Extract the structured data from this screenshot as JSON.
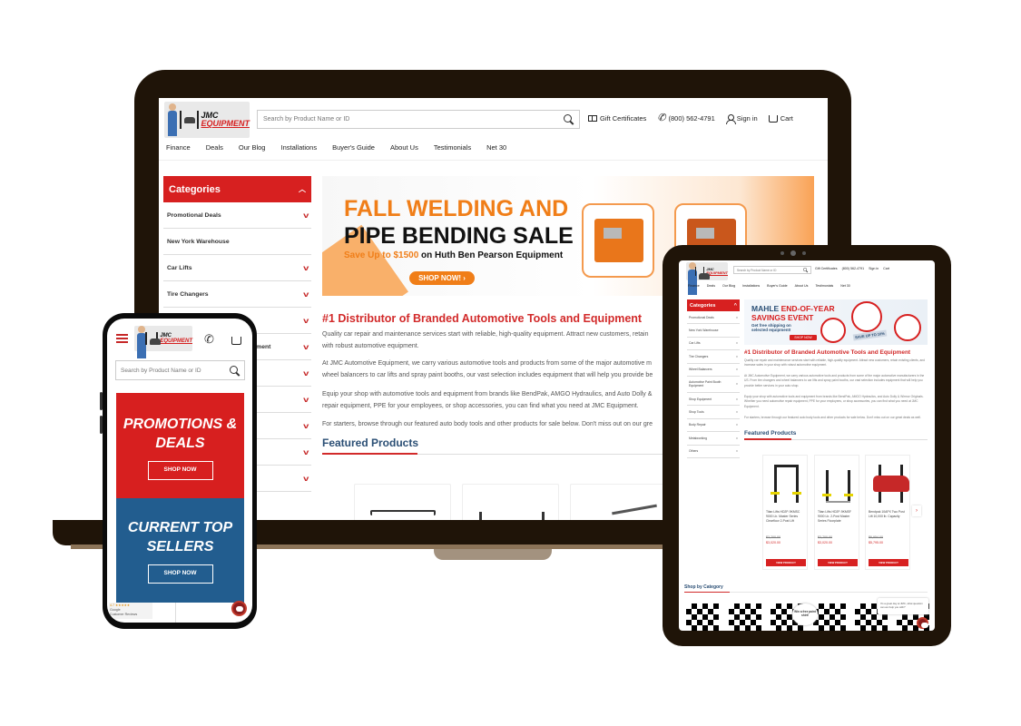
{
  "site": {
    "logo": {
      "line1": "JMC",
      "line2": "EQUIPMENT"
    },
    "search_placeholder": "Search by Product Name or ID",
    "header_links": {
      "gift": "Gift Certificates",
      "phone": "(800) 562-4791",
      "signin": "Sign in",
      "cart": "Cart"
    },
    "nav": [
      "Finance",
      "Deals",
      "Our Blog",
      "Installations",
      "Buyer's Guide",
      "About Us",
      "Testimonials",
      "Net 30"
    ],
    "categories_title": "Categories",
    "categories": [
      "Promotional Deals",
      "New York Warehouse",
      "Car Lifts",
      "Tire Changers",
      "Wheel Balancers",
      "Automotive Paint Booth Equipment",
      "Shop Equipment",
      "Shop Tools",
      "Body Repair",
      "Metalworking",
      "Others"
    ],
    "heading": "#1 Distributor of Branded Automotive Tools and Equipment",
    "paragraphs": [
      "Quality car repair and maintenance services start with reliable, high-quality equipment. Attract new customers, retain existing clients, and increase sales in your shop with robust automotive equipment.",
      "At JMC Automotive Equipment, we carry various automotive tools and products from some of the major automotive manufacturers in the US. From tire changers and wheel balancers to car lifts and spray paint booths, our vast selection includes equipment that will help you provide better services in your auto shop.",
      "Equip your shop with automotive tools and equipment from brands like BendPak, AMGO Hydraulics, and Auto Dolly & Wirmor Originals. Whether you need automotive repair equipment, PPE for your employees, or shop accessories, you can find what you need at JMC Equipment.",
      "For starters, browse through our featured auto body tools and other products for sale below. Don't miss out on our great deals as well."
    ],
    "featured_title": "Featured Products",
    "shop_by_category": "Shop by Category"
  },
  "laptop": {
    "banner": {
      "line1": "FALL WELDING AND",
      "line2": "PIPE BENDING SALE",
      "line3_highlight": "Save Up to $1500",
      "line3_rest": " on Huth Ben Pearson Equipment",
      "cta": "SHOP NOW! ›"
    },
    "para_short": [
      "Quality car repair and maintenance services start with reliable, high-quality equipment. Attract new customers, retain",
      "with robust automotive equipment.",
      "At JMC Automotive Equipment, we carry various automotive tools and products from some of the major automotive m",
      "wheel balancers to car lifts and spray paint booths, our vast selection includes equipment that will help you provide be",
      "Equip your shop with automotive tools and equipment from brands like BendPak, AMGO Hydraulics, and Auto Dolly &",
      "repair equipment, PPE for your employees, or shop accessories, you can find what you need at JMC Equipment.",
      "For starters, browse through our featured auto body tools and other products for sale below. Don't miss out on our gre"
    ]
  },
  "phone": {
    "promo": {
      "title": "PROMOTIONS & DEALS",
      "cta": "SHOP NOW"
    },
    "sellers": {
      "title": "CURRENT TOP SELLERS",
      "cta": "SHOP NOW"
    },
    "reviews": {
      "rating": "4.7 ★★★★★",
      "source": "Google",
      "label": "Customer Reviews"
    }
  },
  "tablet": {
    "banner": {
      "brand": "MAHLE",
      "line1_rest": " END-OF-YEAR",
      "line2": "SAVINGS EVENT",
      "line3": "Get free shipping on selected equipment!",
      "cta": "SHOP NOW",
      "badge": "SAVE UP TO 10%"
    },
    "products": [
      {
        "name": "Titan Lifts HD2P-9KMSC 9000 Lb. Master Series Clearfloor 2-Post Lift",
        "old_price": "$3,700.00",
        "price": "$3,020.00",
        "cta": "VIEW PRODUCT"
      },
      {
        "name": "Titan Lifts HD2P-9KMSF 9000 Lb. 2-Post Master Series Floorplate",
        "old_price": "$3,700.00",
        "price": "$3,020.00",
        "cta": "VIEW PRODUCT"
      },
      {
        "name": "Bendpak 10APX Two Post Lift 10,000 lb. Capacity",
        "old_price": "$6,954.00",
        "price": "$5,795.00",
        "cta": "VIEW PRODUCT"
      }
    ],
    "next_arrow": "›",
    "win_popup": "Win a free paint shirt!",
    "chat_bubble": "It's a great day at JMC, what question can we help you with?"
  },
  "colors": {
    "brand_red": "#d72020",
    "brand_blue": "#225d8f",
    "heading_navy": "#2b4f75",
    "banner_orange": "#f07e18",
    "device_frame": "#1f1408"
  }
}
